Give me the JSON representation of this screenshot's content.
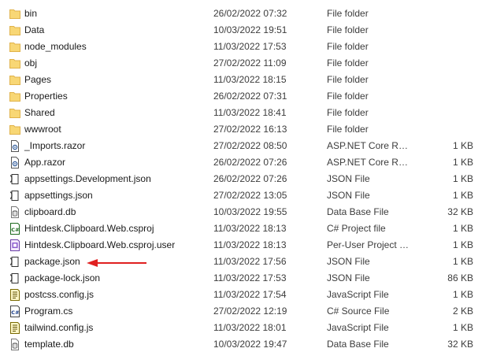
{
  "files": [
    {
      "name": "bin",
      "modified": "26/02/2022 07:32",
      "type": "File folder",
      "size": "",
      "icon": "folder-icon"
    },
    {
      "name": "Data",
      "modified": "10/03/2022 19:51",
      "type": "File folder",
      "size": "",
      "icon": "folder-icon"
    },
    {
      "name": "node_modules",
      "modified": "11/03/2022 17:53",
      "type": "File folder",
      "size": "",
      "icon": "folder-icon"
    },
    {
      "name": "obj",
      "modified": "27/02/2022 11:09",
      "type": "File folder",
      "size": "",
      "icon": "folder-icon"
    },
    {
      "name": "Pages",
      "modified": "11/03/2022 18:15",
      "type": "File folder",
      "size": "",
      "icon": "folder-icon"
    },
    {
      "name": "Properties",
      "modified": "26/02/2022 07:31",
      "type": "File folder",
      "size": "",
      "icon": "folder-icon"
    },
    {
      "name": "Shared",
      "modified": "11/03/2022 18:41",
      "type": "File folder",
      "size": "",
      "icon": "folder-icon"
    },
    {
      "name": "wwwroot",
      "modified": "27/02/2022 16:13",
      "type": "File folder",
      "size": "",
      "icon": "folder-icon"
    },
    {
      "name": "_Imports.razor",
      "modified": "27/02/2022 08:50",
      "type": "ASP.NET Core Raz...",
      "size": "1 KB",
      "icon": "razor-file-icon"
    },
    {
      "name": "App.razor",
      "modified": "26/02/2022 07:26",
      "type": "ASP.NET Core Raz...",
      "size": "1 KB",
      "icon": "razor-file-icon"
    },
    {
      "name": "appsettings.Development.json",
      "modified": "26/02/2022 07:26",
      "type": "JSON File",
      "size": "1 KB",
      "icon": "json-file-icon"
    },
    {
      "name": "appsettings.json",
      "modified": "27/02/2022 13:05",
      "type": "JSON File",
      "size": "1 KB",
      "icon": "json-file-icon"
    },
    {
      "name": "clipboard.db",
      "modified": "10/03/2022 19:55",
      "type": "Data Base File",
      "size": "32 KB",
      "icon": "database-file-icon"
    },
    {
      "name": "Hintdesk.Clipboard.Web.csproj",
      "modified": "11/03/2022 18:13",
      "type": "C# Project file",
      "size": "1 KB",
      "icon": "csproj-file-icon"
    },
    {
      "name": "Hintdesk.Clipboard.Web.csproj.user",
      "modified": "11/03/2022 18:13",
      "type": "Per-User Project O...",
      "size": "1 KB",
      "icon": "user-project-file-icon"
    },
    {
      "name": "package.json",
      "modified": "11/03/2022 17:56",
      "type": "JSON File",
      "size": "1 KB",
      "icon": "json-file-icon"
    },
    {
      "name": "package-lock.json",
      "modified": "11/03/2022 17:53",
      "type": "JSON File",
      "size": "86 KB",
      "icon": "json-file-icon"
    },
    {
      "name": "postcss.config.js",
      "modified": "11/03/2022 17:54",
      "type": "JavaScript File",
      "size": "1 KB",
      "icon": "javascript-file-icon"
    },
    {
      "name": "Program.cs",
      "modified": "27/02/2022 12:19",
      "type": "C# Source File",
      "size": "2 KB",
      "icon": "csharp-file-icon"
    },
    {
      "name": "tailwind.config.js",
      "modified": "11/03/2022 18:01",
      "type": "JavaScript File",
      "size": "1 KB",
      "icon": "javascript-file-icon"
    },
    {
      "name": "template.db",
      "modified": "10/03/2022 19:47",
      "type": "Data Base File",
      "size": "32 KB",
      "icon": "database-file-icon"
    }
  ],
  "colors": {
    "folder": "#f8d775",
    "folder_dark": "#e0b24a",
    "annotation_arrow": "#e02020",
    "hover": "#e5f3ff"
  }
}
